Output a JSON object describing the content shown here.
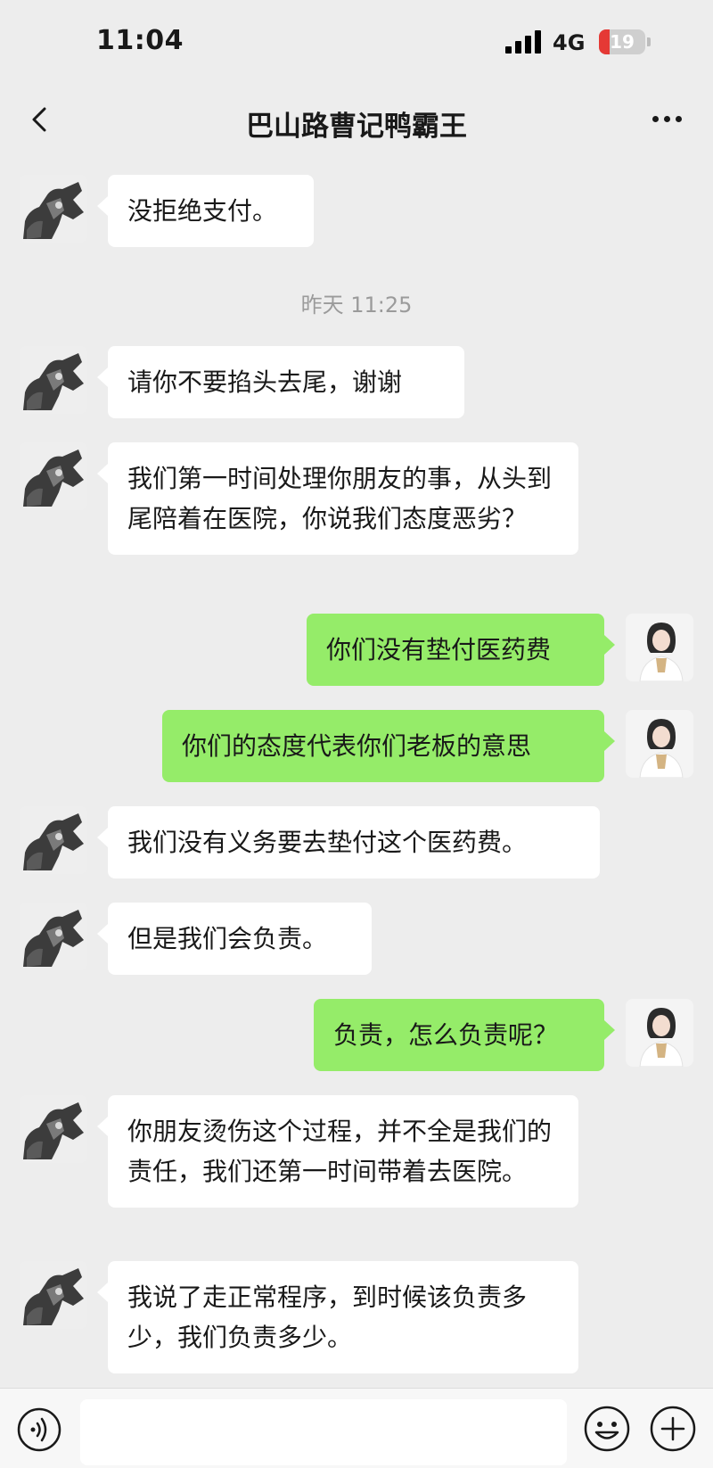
{
  "status_bar": {
    "time": "11:04",
    "network": "4G",
    "battery": "19"
  },
  "header": {
    "title": "巴山路曹记鸭霸王"
  },
  "chat": {
    "timestamp": "昨天 11:25",
    "messages": [
      {
        "side": "left",
        "text": "没拒绝支付。"
      },
      {
        "side": "left",
        "text": "请你不要掐头去尾，谢谢"
      },
      {
        "side": "left",
        "text": "我们第一时间处理你朋友的事，从头到尾陪着在医院，你说我们态度恶劣？"
      },
      {
        "side": "right",
        "text": "你们没有垫付医药费"
      },
      {
        "side": "right",
        "text": "你们的态度代表你们老板的意思"
      },
      {
        "side": "left",
        "text": "我们没有义务要去垫付这个医药费。"
      },
      {
        "side": "left",
        "text": "但是我们会负责。"
      },
      {
        "side": "right",
        "text": "负责，怎么负责呢？"
      },
      {
        "side": "left",
        "text": "你朋友烫伤这个过程，并不全是我们的责任，我们还第一时间带着去医院。"
      },
      {
        "side": "left",
        "text": "我说了走正常程序，到时候该负责多少，我们负责多少。"
      }
    ]
  },
  "colors": {
    "background": "#ededed",
    "bubble_left": "#ffffff",
    "bubble_right": "#95ec69",
    "timestamp": "#9b9b9b"
  },
  "icons": {
    "back": "chevron-left-icon",
    "more": "more-dots-icon",
    "voice": "voice-icon",
    "emoji": "emoji-icon",
    "plus": "plus-icon"
  }
}
